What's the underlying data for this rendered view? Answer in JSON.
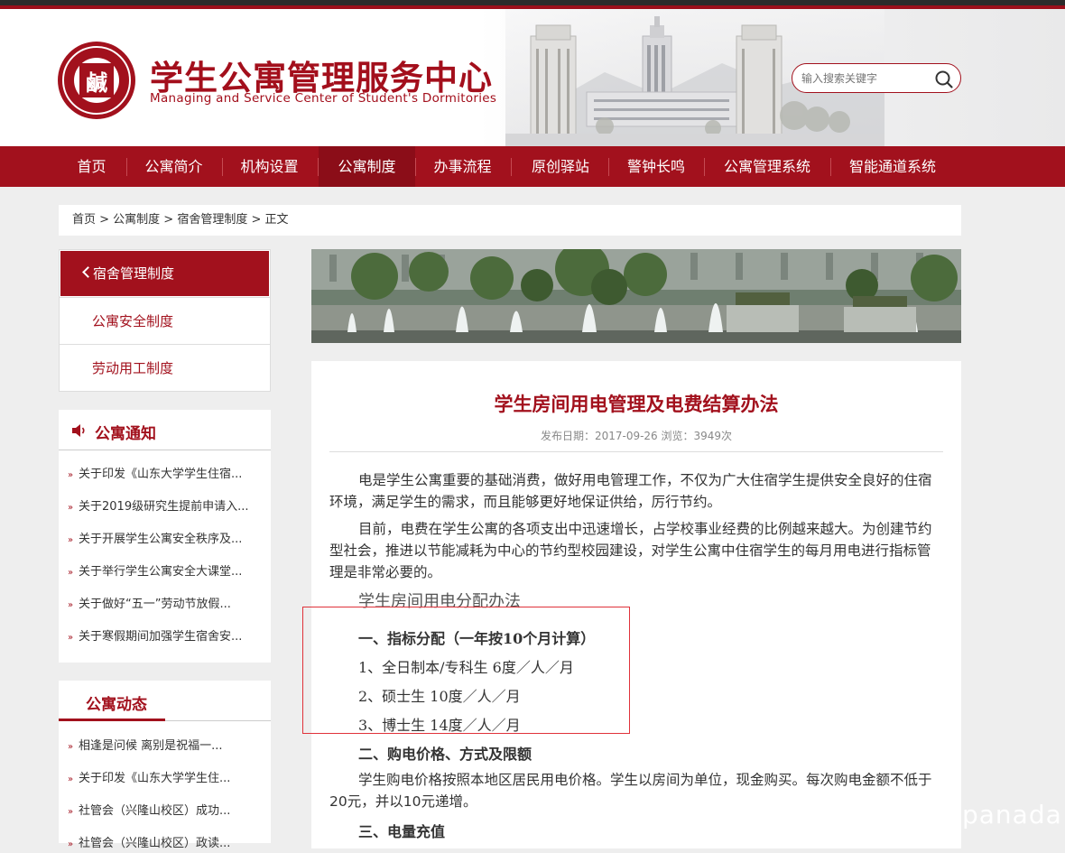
{
  "header": {
    "title": "学生公寓管理服务中心",
    "subtitle": "Managing and Service Center of Student's  Dormitories",
    "logo_glyph": "鹹",
    "search_placeholder": "输入搜索关键字"
  },
  "nav": {
    "items": [
      "首页",
      "公寓简介",
      "机构设置",
      "公寓制度",
      "办事流程",
      "原创驿站",
      "警钟长鸣",
      "公寓管理系统",
      "智能通道系统"
    ],
    "active": "公寓制度"
  },
  "breadcrumb": {
    "text": "首页 > 公寓制度 > 宿舍管理制度 > 正文"
  },
  "subnav": {
    "title": "宿舍管理制度",
    "items": [
      "公寓安全制度",
      "劳动用工制度"
    ]
  },
  "notice": {
    "title": "公寓通知",
    "items": [
      "关于印发《山东大学学生住宿...",
      "关于2019级研究生提前申请入...",
      "关于开展学生公寓安全秩序及...",
      "关于举行学生公寓安全大课堂...",
      "关于做好“五一”劳动节放假...",
      "关于寒假期间加强学生宿舍安..."
    ]
  },
  "news": {
    "title": "公寓动态",
    "items": [
      "相逢是问候 离别是祝福一...",
      "关于印发《山东大学学生住...",
      "社管会（兴隆山校区）成功...",
      "社管会（兴隆山校区）政读..."
    ]
  },
  "article": {
    "title": "学生房间用电管理及电费结算办法",
    "meta": "发布日期：2017-09-26    浏览：3949次",
    "p1": "电是学生公寓重要的基础消费，做好用电管理工作，不仅为广大住宿学生提供安全良好的住宿环境，满足学生的需求，而且能够更好地保证供给，厉行节约。",
    "p2": "目前，电费在学生公寓的各项支出中迅速增长，占学校事业经费的比例越来越大。为创建节约型社会，推进以节能减耗为中心的节约型校园建设，对学生公寓中住宿学生的每月用电进行指标管理是非常必要的。",
    "section_heading": "学生房间用电分配办法",
    "s1": "一、指标分配（一年按10个月计算）",
    "s1_1": "1、全日制本/专科生 6度／人／月",
    "s1_2": "2、硕士生 10度／人／月",
    "s1_3": "3、博士生 14度／人／月",
    "s2": "二、购电价格、方式及限额",
    "p3": "学生购电价格按照本地区居民用电价格。学生以房间为单位，现金购买。每次购电金额不低于20元，并以10元递增。",
    "s3": "三、电量充值"
  },
  "watermark": "panada",
  "colors": {
    "brand": "#a2111d",
    "nav_active": "#8b0d18"
  }
}
